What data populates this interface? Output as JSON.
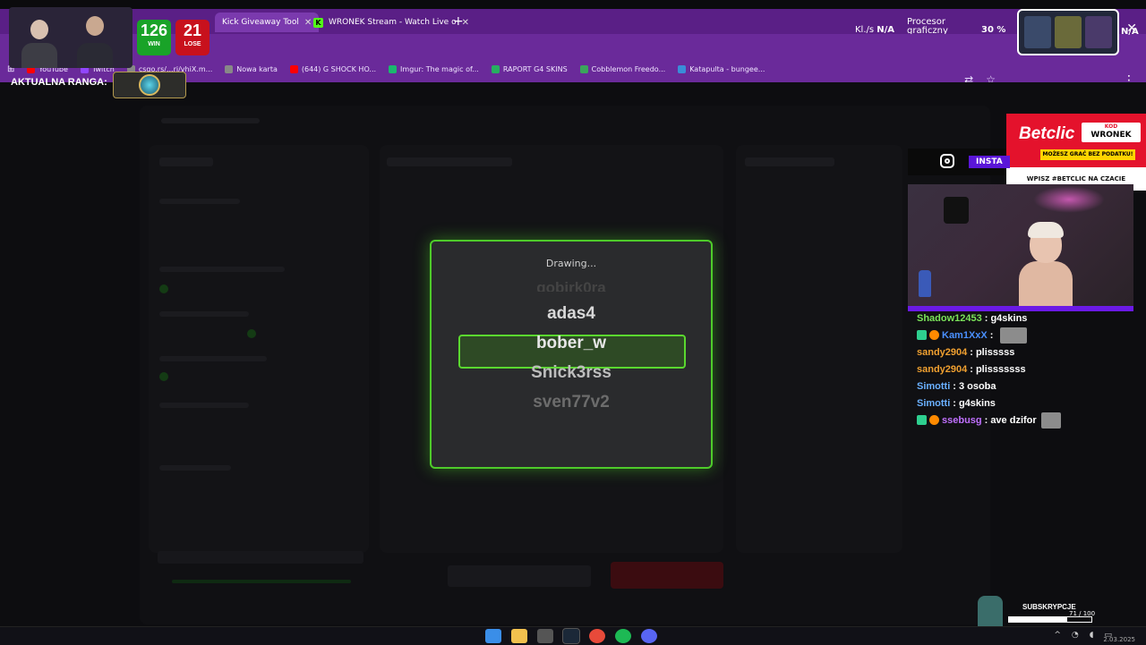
{
  "browser": {
    "tabs": [
      {
        "label": "Kick Giveaway Tool",
        "active": true
      },
      {
        "label": "WRONEK Stream - Watch Live o",
        "active": false
      }
    ],
    "new_tab": "+",
    "bookmarks": [
      {
        "label": "YouTube",
        "color": "#ff0000"
      },
      {
        "label": "Twitch",
        "color": "#9146ff"
      },
      {
        "label": "csgo.rs/...ri/vhiX.m...",
        "color": "#888888"
      },
      {
        "label": "Nowa karta",
        "color": "#888888"
      },
      {
        "label": "(644) G SHOCK HO...",
        "color": "#ff0000"
      },
      {
        "label": "Imgur: The magic of...",
        "color": "#1bb76e"
      },
      {
        "label": "RAPORT G4 SKINS",
        "color": "#27ae60"
      },
      {
        "label": "Cobblemon Freedo...",
        "color": "#3ba55c"
      },
      {
        "label": "Katapulta - bungee...",
        "color": "#3a8dd8"
      }
    ]
  },
  "overlay_stats": {
    "fps_label": "Kl./s",
    "fps_value": "N/A",
    "gpu_label_1": "Procesor",
    "gpu_label_2": "graficzny",
    "gpu_value": "30 %",
    "right_value": "N/A"
  },
  "scores": {
    "win_value": "126",
    "win_label": "WIN",
    "lose_value": "21",
    "lose_label": "LOSE"
  },
  "rank": {
    "label": "AKTUALNA RANGA:"
  },
  "modal": {
    "status": "Drawing...",
    "names": [
      "gobirk0ra",
      "adas4",
      "bober_w",
      "Snick3rss",
      "sven77v2"
    ],
    "selected_index": 2
  },
  "betclic": {
    "logo": "Betclic",
    "code_label": "KOD",
    "code": "WRONEK",
    "tagline": "MOŻESZ GRAĆ BEZ PODATKU!",
    "footer": "WPISZ #BETCLIC NA CZACIE"
  },
  "instagram": {
    "label": "INSTA"
  },
  "chat": [
    {
      "user": "Shadow12453",
      "color": "#7be35a",
      "msg": "g4skins",
      "badges": 0,
      "emote": false
    },
    {
      "user": "Kam1XxX",
      "color": "#4a90ff",
      "msg": "",
      "badges": 2,
      "emote": true
    },
    {
      "user": "sandy2904",
      "color": "#f0a030",
      "msg": "plisssss",
      "badges": 0,
      "emote": false
    },
    {
      "user": "sandy2904",
      "color": "#f0a030",
      "msg": "plisssssss",
      "badges": 0,
      "emote": false
    },
    {
      "user": "Simotti",
      "color": "#6ab0ff",
      "msg": "3 osoba",
      "badges": 0,
      "emote": false
    },
    {
      "user": "Simotti",
      "color": "#6ab0ff",
      "msg": "g4skins",
      "badges": 0,
      "emote": false
    },
    {
      "user": "ssebusg",
      "color": "#c070ff",
      "msg": "ave dzifor",
      "badges": 2,
      "emote": true
    }
  ],
  "subs": {
    "title": "SUBSKRYPCJE",
    "count": "71 / 100",
    "progress": 0.71
  },
  "taskbar": {
    "apps": [
      {
        "name": "windows",
        "color": "#3a8ee8"
      },
      {
        "name": "explorer",
        "color": "#f2c14e"
      },
      {
        "name": "obs",
        "color": "#555555"
      },
      {
        "name": "steam",
        "color": "#1b2838"
      },
      {
        "name": "chrome",
        "color": "#e84a3a"
      },
      {
        "name": "spotify",
        "color": "#1db954"
      },
      {
        "name": "discord",
        "color": "#5865f2"
      }
    ],
    "clock": "2.03.2025"
  }
}
